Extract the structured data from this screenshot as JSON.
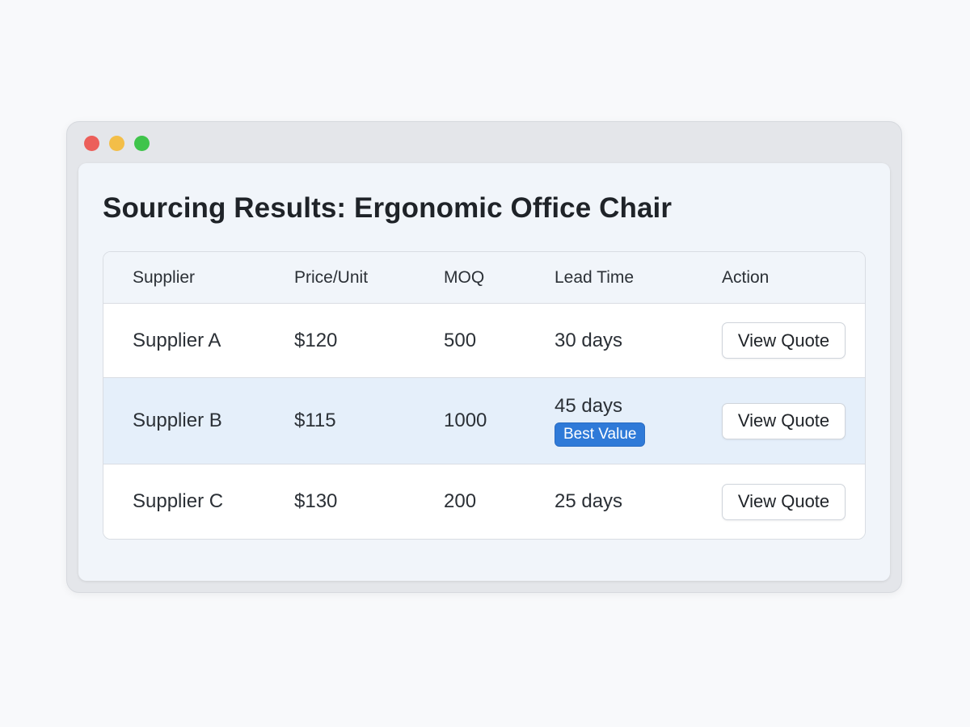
{
  "window": {
    "controls": [
      "close",
      "minimize",
      "maximize"
    ]
  },
  "page": {
    "title": "Sourcing Results: Ergonomic Office Chair"
  },
  "table": {
    "columns": [
      "Supplier",
      "Price/Unit",
      "MOQ",
      "Lead Time",
      "Action"
    ],
    "rows": [
      {
        "supplier": "Supplier A",
        "price": "$120",
        "moq": "500",
        "lead_time": "30 days",
        "badge": null,
        "action_label": "View Quote",
        "highlighted": false
      },
      {
        "supplier": "Supplier B",
        "price": "$115",
        "moq": "1000",
        "lead_time": "45 days",
        "badge": "Best Value",
        "action_label": "View Quote",
        "highlighted": true
      },
      {
        "supplier": "Supplier C",
        "price": "$130",
        "moq": "200",
        "lead_time": "25 days",
        "badge": null,
        "action_label": "View Quote",
        "highlighted": false
      }
    ]
  },
  "colors": {
    "accent": "#2f7ad8",
    "highlight_row": "#e5effa",
    "close": "#ec5f5a",
    "minimize": "#f3be48",
    "maximize": "#3fc44b"
  }
}
